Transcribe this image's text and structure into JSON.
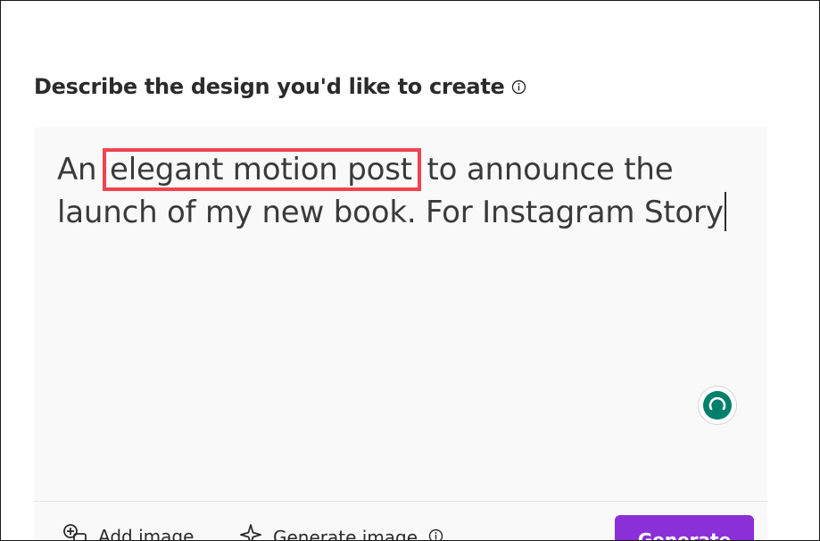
{
  "heading": {
    "title": "Describe the design you'd like to create"
  },
  "prompt": {
    "before": "An ",
    "highlight": "elegant motion post",
    "after": " to announce the launch of my new book. For Instagram Story"
  },
  "toolbar": {
    "add_image_label": "Add image",
    "generate_image_label": "Generate image",
    "generate_label": "Generate"
  },
  "colors": {
    "accent": "#8b2fd9",
    "highlight_border": "#f0444f",
    "spinner": "#00806c",
    "editor_bg": "#f9f9f9"
  },
  "icons": {
    "info": "info-icon",
    "spinner": "loading-spinner-icon",
    "add_image": "add-image-icon",
    "generate_image": "sparkle-icon"
  }
}
